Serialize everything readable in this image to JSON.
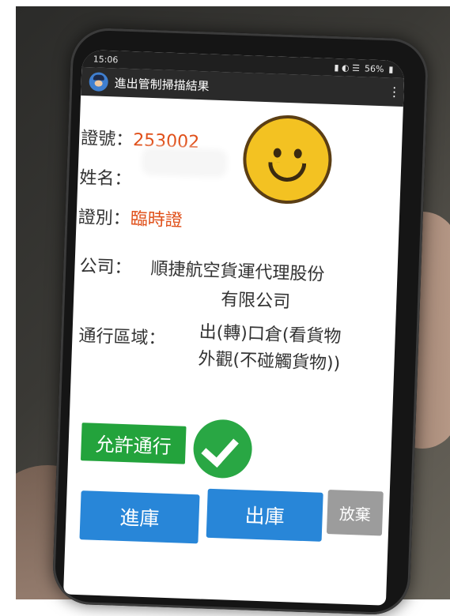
{
  "status_bar": {
    "time": "15:06",
    "battery": "56%"
  },
  "app_bar": {
    "title": "進出管制掃描結果"
  },
  "fields": {
    "cert_no_label": "證號：",
    "cert_no_value": "253002",
    "name_label": "姓名：",
    "cert_type_label": "證別：",
    "cert_type_value": "臨時證",
    "company_label": "公司：",
    "company_line1": "順捷航空貨運代理股份",
    "company_line2": "有限公司",
    "area_label": "通行區域：",
    "area_line1": "出(轉)口倉(看貨物",
    "area_line2": "外觀(不碰觸貨物))"
  },
  "result": {
    "status_label": "允許通行"
  },
  "actions": {
    "inbound": "進庫",
    "outbound": "出庫",
    "abandon": "放棄"
  },
  "colors": {
    "value_red": "#e0501a",
    "allow_green": "#23a33c",
    "button_blue": "#2886d8",
    "button_gray": "#9c9c9c"
  }
}
